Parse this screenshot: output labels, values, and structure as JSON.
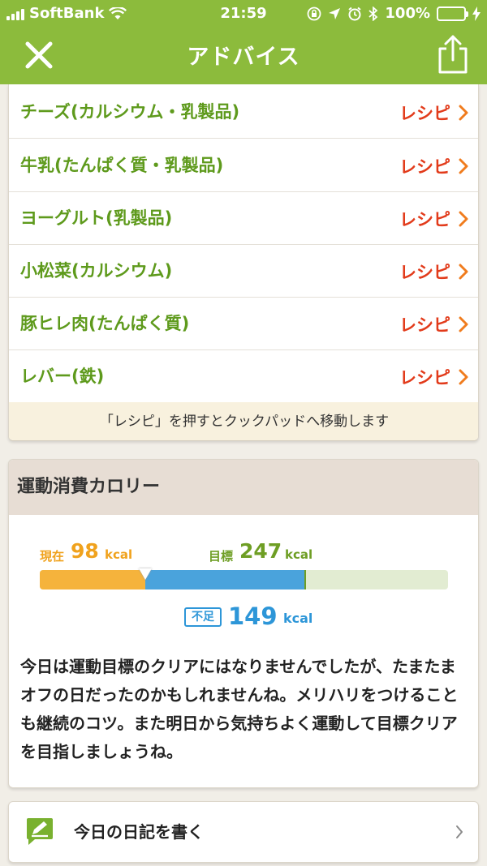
{
  "status_bar": {
    "carrier": "SoftBank",
    "time": "21:59",
    "battery": "100%"
  },
  "header": {
    "title": "アドバイス"
  },
  "recipes": {
    "items": [
      {
        "food": "チーズ(カルシウム・乳製品)",
        "link": "レシピ"
      },
      {
        "food": "牛乳(たんぱく質・乳製品)",
        "link": "レシピ"
      },
      {
        "food": "ヨーグルト(乳製品)",
        "link": "レシピ"
      },
      {
        "food": "小松菜(カルシウム)",
        "link": "レシピ"
      },
      {
        "food": "豚ヒレ肉(たんぱく質)",
        "link": "レシピ"
      },
      {
        "food": "レバー(鉄)",
        "link": "レシピ"
      }
    ],
    "note": "「レシピ」を押すとクックパッドへ移動します"
  },
  "exercise": {
    "title": "運動消費カロリー",
    "current_label": "現在",
    "current_value": "98",
    "goal_label": "目標",
    "goal_value": "247",
    "unit": "kcal",
    "shortage_label": "不足",
    "shortage_value": "149",
    "bar": {
      "scale_max": 380,
      "current": 98,
      "goal": 247,
      "color_current": "#f5b33c",
      "color_shortage": "#4aa3dc",
      "color_remaining": "#e2ecd2"
    },
    "advice": "今日は運動目標のクリアにはなりませんでしたが、たまたまオフの日だったのかもしれませんね。メリハリをつけることも継続のコツ。また明日から気持ちよく運動して目標クリアを目指しましょうね。"
  },
  "diary": {
    "label": "今日の日記を書く"
  },
  "icons": {
    "close": "close-icon",
    "share": "share-icon",
    "chevron": "chevron-right-icon",
    "pen": "pen-icon"
  },
  "colors": {
    "brand_green": "#8cbb3c",
    "food_green": "#5e9a1c",
    "recipe_red": "#e23b1b",
    "chevron_orange": "#f07c1e",
    "shortage_blue": "#2d96d8"
  }
}
